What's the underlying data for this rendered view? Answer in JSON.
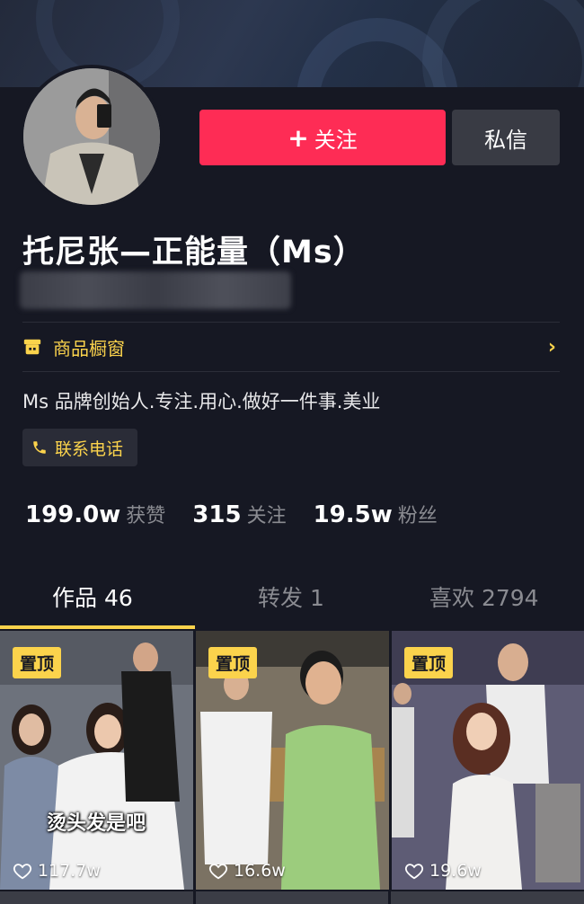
{
  "profile": {
    "follow_label": "关注",
    "follow_plus": "+",
    "message_label": "私信",
    "name": "托尼张—正能量（Ms）",
    "shop_window": "商品橱窗",
    "bio": "Ms 品牌创始人.专注.用心.做好一件事.美业",
    "contact_label": "联系电话"
  },
  "stats": [
    {
      "value": "199.0w",
      "label": "获赞"
    },
    {
      "value": "315",
      "label": "关注"
    },
    {
      "value": "19.5w",
      "label": "粉丝"
    }
  ],
  "tabs": [
    {
      "label": "作品 46",
      "active": true
    },
    {
      "label": "转发 1",
      "active": false
    },
    {
      "label": "喜欢 2794",
      "active": false
    }
  ],
  "videos": [
    {
      "pinned_label": "置顶",
      "likes": "117.7w",
      "caption": "烫头发是吧"
    },
    {
      "pinned_label": "置顶",
      "likes": "16.6w"
    },
    {
      "pinned_label": "置顶",
      "likes": "19.6w"
    }
  ],
  "colors": {
    "background": "#161823",
    "follow_button": "#fe2c55",
    "message_button": "#393b44",
    "accent_yellow": "#fbd34c"
  },
  "icons": {
    "shop": "storefront-icon",
    "chevron": "chevron-right-icon",
    "phone": "phone-icon",
    "heart": "heart-outline-icon"
  }
}
